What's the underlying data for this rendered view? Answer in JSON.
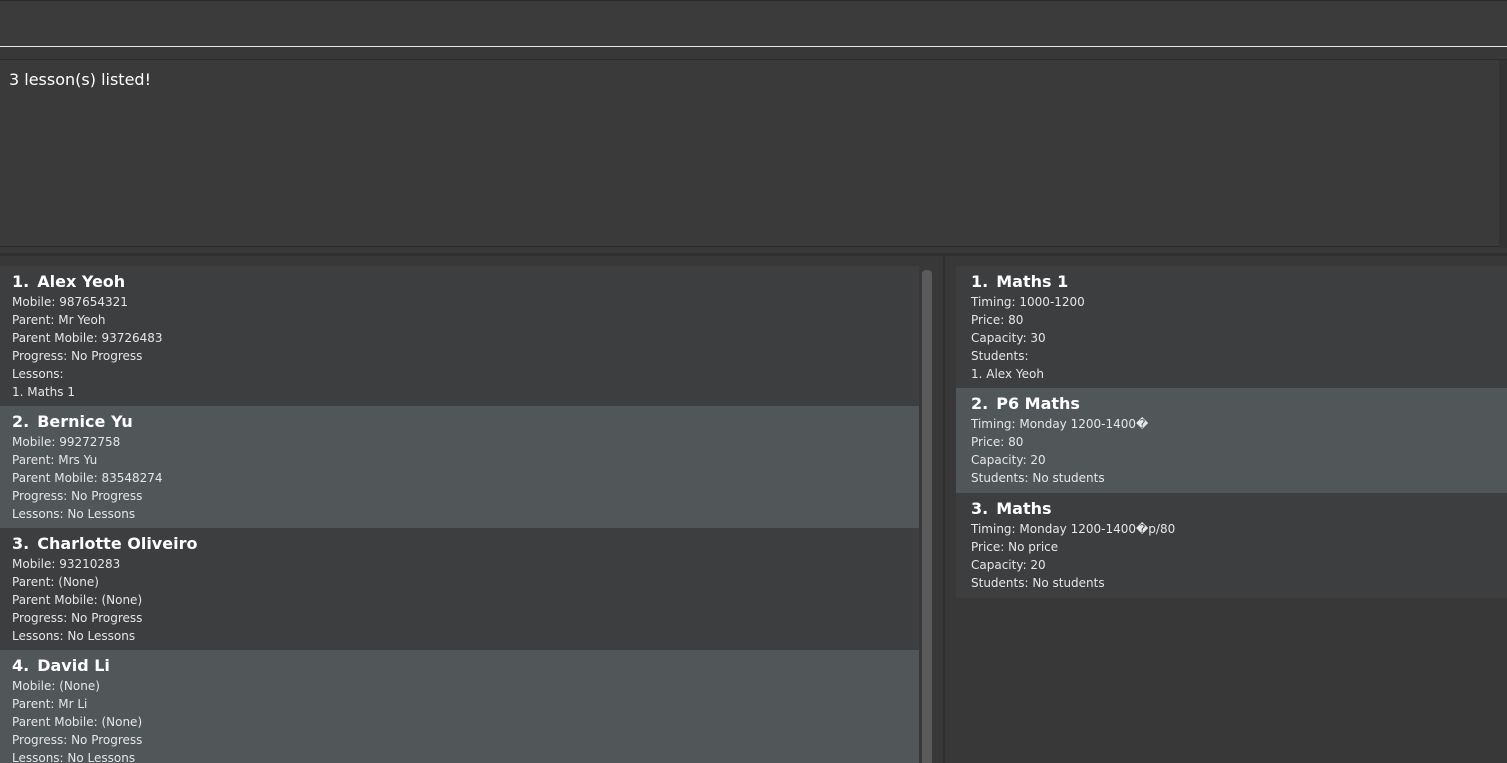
{
  "command": {
    "value": "",
    "placeholder": ""
  },
  "result": {
    "message": "3 lesson(s) listed!"
  },
  "students": [
    {
      "index": "1.",
      "name": "Alex Yeoh",
      "mobile": "Mobile: 987654321",
      "parent": "Parent: Mr Yeoh",
      "parent_mobile": "Parent Mobile: 93726483",
      "progress": "Progress: No Progress",
      "lessons": "Lessons:",
      "lesson_items": [
        "1.  Maths 1"
      ]
    },
    {
      "index": "2.",
      "name": "Bernice Yu",
      "mobile": "Mobile: 99272758",
      "parent": "Parent: Mrs Yu",
      "parent_mobile": "Parent Mobile: 83548274",
      "progress": "Progress: No Progress",
      "lessons": "Lessons: No Lessons",
      "lesson_items": []
    },
    {
      "index": "3.",
      "name": "Charlotte Oliveiro",
      "mobile": "Mobile: 93210283",
      "parent": "Parent: (None)",
      "parent_mobile": "Parent Mobile: (None)",
      "progress": "Progress: No Progress",
      "lessons": "Lessons: No Lessons",
      "lesson_items": []
    },
    {
      "index": "4.",
      "name": "David Li",
      "mobile": "Mobile: (None)",
      "parent": "Parent: Mr Li",
      "parent_mobile": "Parent Mobile: (None)",
      "progress": "Progress: No Progress",
      "lessons": "Lessons: No Lessons",
      "lesson_items": []
    }
  ],
  "lessons": [
    {
      "index": "1.",
      "name": "Maths 1",
      "timing": "Timing: 1000-1200",
      "price": "Price: 80",
      "capacity": "Capacity: 30",
      "students": "Students:",
      "student_items": [
        "1.  Alex Yeoh"
      ]
    },
    {
      "index": "2.",
      "name": "P6 Maths",
      "timing": "Timing: Monday 1200-1400�",
      "price": "Price: 80",
      "capacity": "Capacity: 20",
      "students": "Students: No students",
      "student_items": []
    },
    {
      "index": "3.",
      "name": "Maths",
      "timing": "Timing: Monday 1200-1400�p/80",
      "price": "Price: No price",
      "capacity": "Capacity: 20",
      "students": "Students: No students",
      "student_items": []
    }
  ]
}
